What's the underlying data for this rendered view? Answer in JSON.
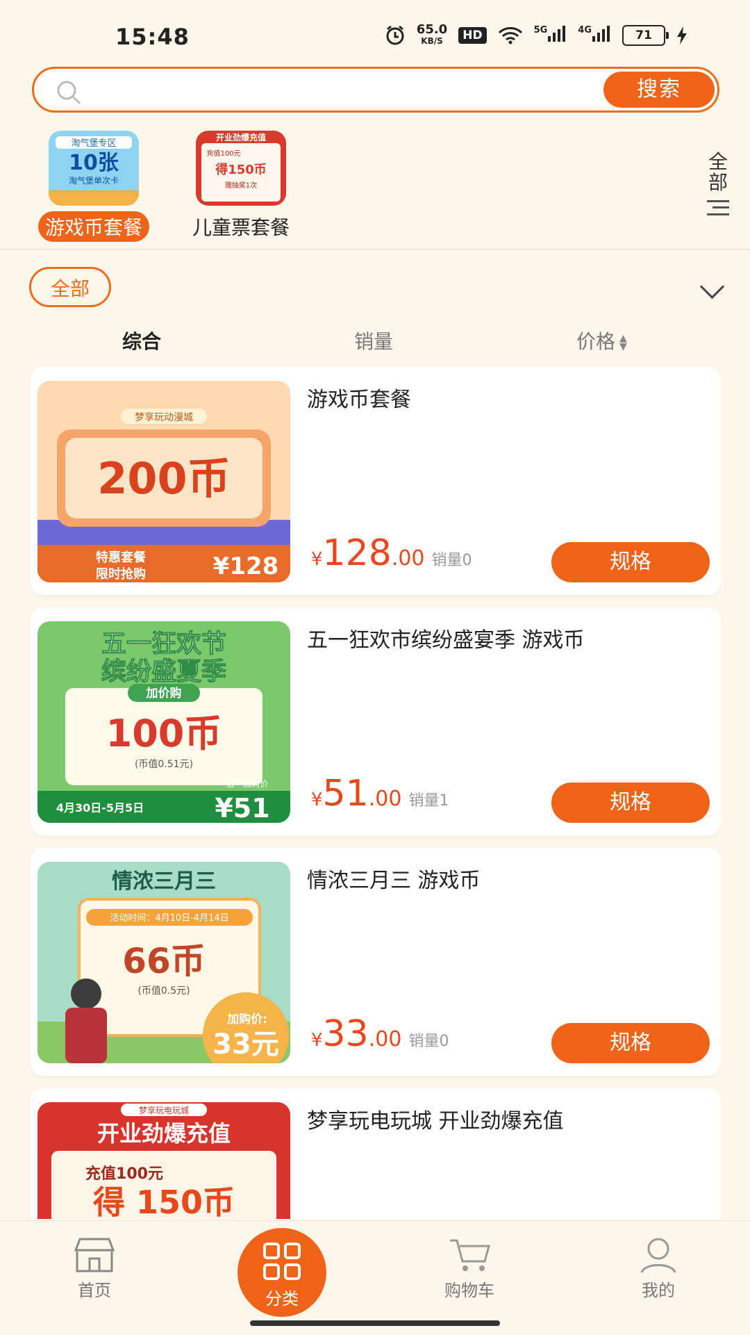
{
  "status": {
    "time": "15:48",
    "net_speed_top": "65.0",
    "net_speed_bottom": "KB/S",
    "hd": "HD",
    "sig1": "5G",
    "sig2": "4G",
    "battery": "71"
  },
  "search": {
    "placeholder": "",
    "button_label": "搜索"
  },
  "categories": [
    {
      "label": "游戏币套餐",
      "active": true
    },
    {
      "label": "儿童票套餐",
      "active": false
    }
  ],
  "all_categories_label": "全部",
  "filter": {
    "all_label": "全部"
  },
  "sort": {
    "comprehensive": "综合",
    "sales": "销量",
    "price": "价格"
  },
  "products": [
    {
      "title": "游戏币套餐",
      "yen": "¥",
      "price_int": "128",
      "price_dec": ".00",
      "sales": "销量0",
      "button": "规格",
      "thumb": {
        "top": "梦享玩动漫城",
        "big": "200币",
        "tag1": "特惠套餐",
        "tag2": "限时抢购",
        "price": "¥128"
      }
    },
    {
      "title": "五一狂欢市缤纷盛宴季 游戏币",
      "yen": "¥",
      "price_int": "51",
      "price_dec": ".00",
      "sales": "销量1",
      "button": "规格",
      "thumb": {
        "line1": "五一狂欢节",
        "line2": "缤纷盛夏季",
        "tag": "加价购",
        "big": "100币",
        "sub": "(币值0.51元)",
        "date": "4月30日-5月5日",
        "pricelbl": "五一加购价",
        "price": "¥51"
      }
    },
    {
      "title": "情浓三月三 游戏币",
      "yen": "¥",
      "price_int": "33",
      "price_dec": ".00",
      "sales": "销量0",
      "button": "规格",
      "thumb": {
        "top": "情浓三月三",
        "time": "活动时间：4月10日-4月14日",
        "big": "66币",
        "sub": "(币值0.5元)",
        "pricelbl": "加购价:",
        "price": "33元"
      }
    },
    {
      "title": "梦享玩电玩城 开业劲爆充值",
      "yen": "",
      "price_int": "",
      "price_dec": "",
      "sales": "",
      "button": "",
      "thumb": {
        "top": "梦享玩电玩城",
        "banner": "开业劲爆充值",
        "line": "充值100元",
        "big": "得 150币"
      }
    }
  ],
  "cat_thumbs": {
    "c1": {
      "l1": "淘气堡专区",
      "l2": "10张",
      "l3": "淘气堡单次卡"
    },
    "c2": {
      "l1": "开业劲爆充值",
      "l2": "充值100元",
      "l3": "得150币",
      "l4": "赠抽奖1次"
    }
  },
  "nav": {
    "home": "首页",
    "category": "分类",
    "cart": "购物车",
    "me": "我的"
  },
  "colors": {
    "accent": "#f0641a",
    "price": "#e8481b",
    "bg": "#fdf6ea"
  }
}
